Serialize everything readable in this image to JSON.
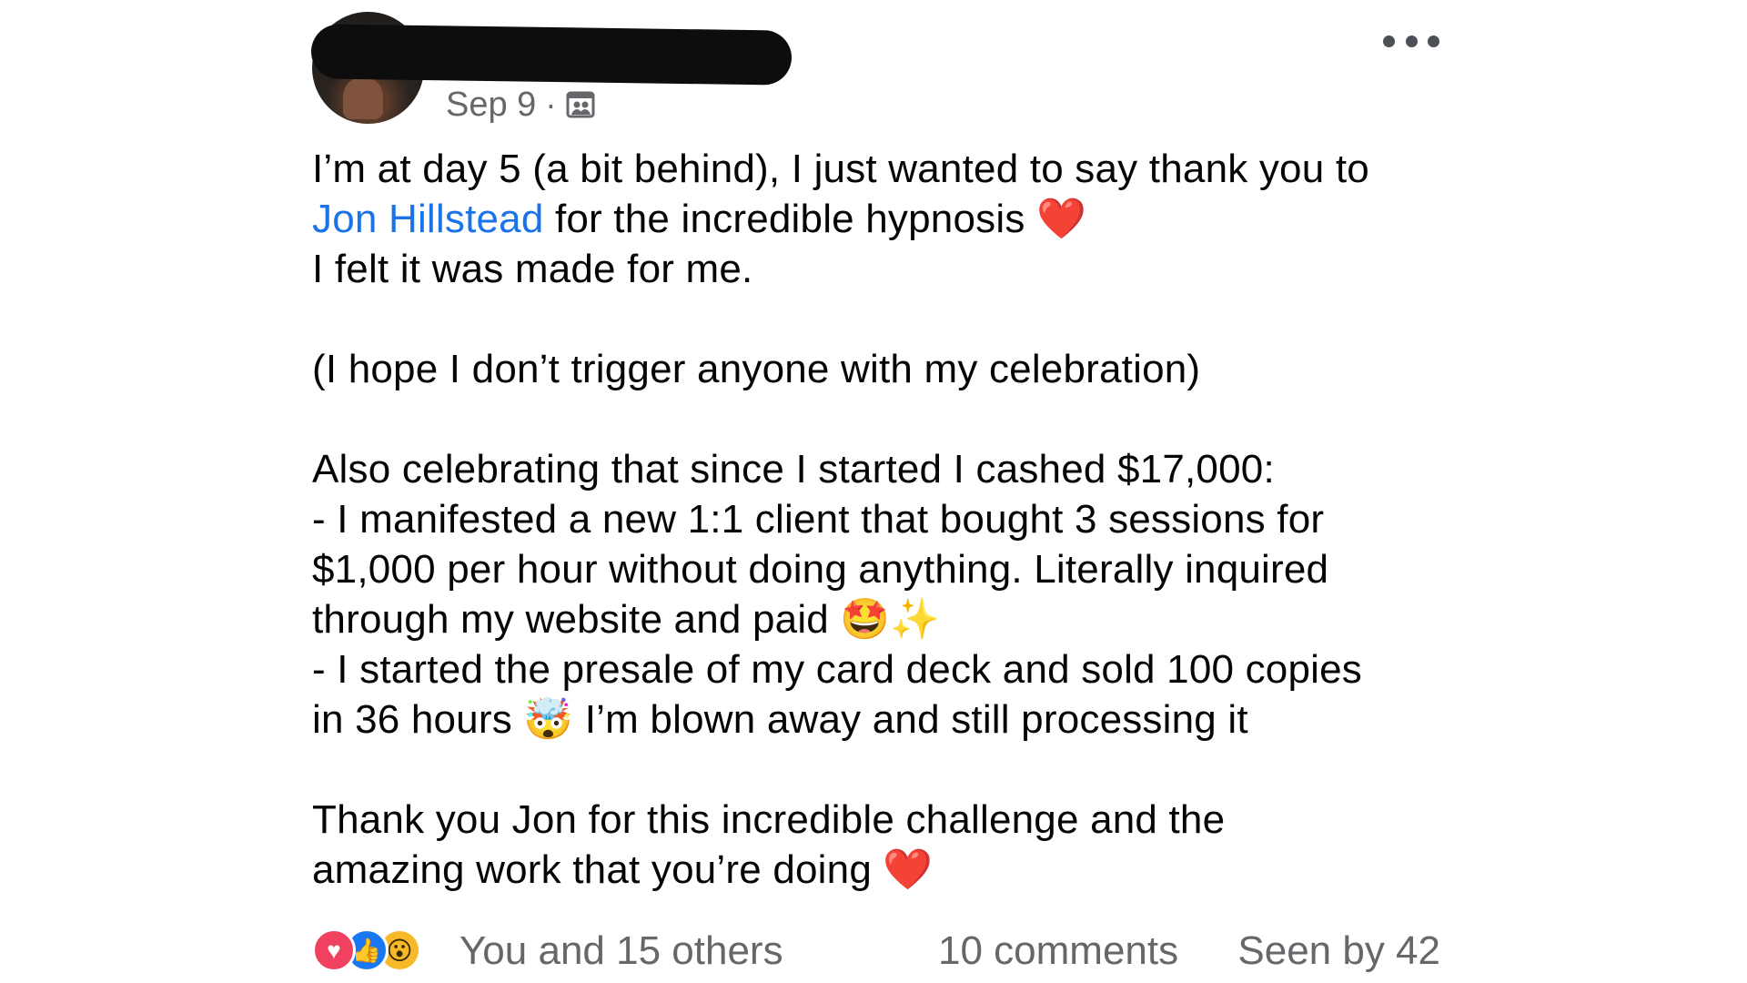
{
  "post": {
    "author_redacted": true,
    "date": "Sep 9",
    "separator": "·",
    "audience_icon": "group-audience-icon",
    "more_icon": "more-options-icon",
    "lines": {
      "l1": "I’m at day 5 (a bit behind), I just wanted to say thank you to",
      "l2_mention": "Jon Hillstead",
      "l2_rest": " for the incredible hypnosis ",
      "l2_emoji": "❤️",
      "l3": "I felt it was made for me.",
      "l5": "(I hope I don’t trigger anyone with my celebration)",
      "l7": "Also celebrating that since I started I cashed $17,000:",
      "l8": "- I manifested a new 1:1 client that bought 3 sessions for",
      "l9": "$1,000 per hour without doing anything. Literally inquired",
      "l10_text": "through my website and paid ",
      "l10_emoji": "🤩✨",
      "l11": "- I started the presale of my card deck and sold 100 copies",
      "l12_a": "in 36 hours ",
      "l12_emoji": "🤯",
      "l12_b": " I’m blown away and still processing it",
      "l14": "Thank you  Jon for this incredible challenge and the",
      "l15_text": "amazing work that you’re doing ",
      "l15_emoji": "❤️"
    },
    "highlight_color": "#fbf7a0",
    "mention_color": "#1a73e8"
  },
  "footer": {
    "reactions": [
      {
        "name": "love",
        "glyph": "♥",
        "color": "#f0425f"
      },
      {
        "name": "like",
        "glyph": "👍",
        "color": "#1877f2"
      },
      {
        "name": "wow",
        "glyph": "😮",
        "color": "#f7b928"
      }
    ],
    "reaction_summary": "You and 15 others",
    "comments": "10 comments",
    "seen": "Seen by 42"
  }
}
